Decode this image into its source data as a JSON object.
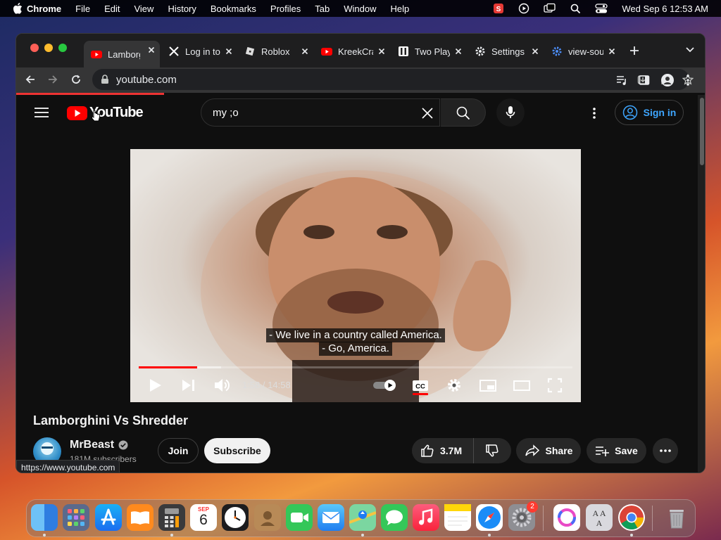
{
  "menubar": {
    "items": [
      "Chrome",
      "File",
      "Edit",
      "View",
      "History",
      "Bookmarks",
      "Profiles",
      "Tab",
      "Window",
      "Help"
    ],
    "datetime": "Wed Sep 6  12:53 AM"
  },
  "tabs": [
    {
      "label": "Lamborghini",
      "icon": "youtube-icon"
    },
    {
      "label": "Log in to",
      "icon": "x-logo-icon"
    },
    {
      "label": "Roblox",
      "icon": "roblox-icon"
    },
    {
      "label": "KreekCraft",
      "icon": "youtube-icon"
    },
    {
      "label": "Two Player",
      "icon": "game-icon"
    },
    {
      "label": "Settings",
      "icon": "gear-icon"
    },
    {
      "label": "view-source",
      "icon": "gear-icon"
    }
  ],
  "address": {
    "url": "youtube.com"
  },
  "youtube": {
    "logo_text": "YouTube",
    "search_value": "my ;o",
    "signin_label": "Sign in",
    "captions": [
      "- We live in a country called America.",
      "- Go, America."
    ],
    "time": "1:58 / 14:58",
    "progress_played": 0.135,
    "progress_buffered": 0.19,
    "video_title": "Lamborghini Vs Shredder",
    "channel": "MrBeast",
    "subscribers": "181M subscribers",
    "join_label": "Join",
    "subscribe_label": "Subscribe",
    "likes": "3.7M",
    "share_label": "Share",
    "save_label": "Save"
  },
  "status_url": "https://www.youtube.com",
  "dock": {
    "apps": [
      "finder",
      "launchpad",
      "app-store",
      "books",
      "calculator",
      "calendar",
      "clock",
      "contacts",
      "facetime",
      "mail",
      "maps",
      "messages",
      "music",
      "notes",
      "safari",
      "system-settings",
      "polaris",
      "font-book",
      "chrome",
      "trash"
    ],
    "calendar_month": "SEP",
    "calendar_day": "6",
    "settings_badge": "2"
  },
  "colors": {
    "accent": "#ff0000",
    "link": "#3ea6ff",
    "bg": "#0f0f0f"
  }
}
